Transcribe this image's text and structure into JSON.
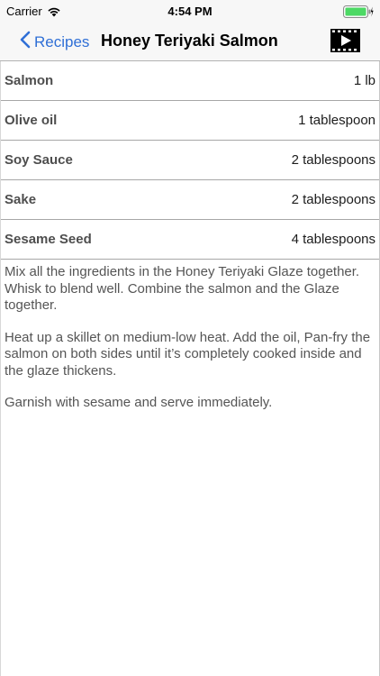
{
  "status_bar": {
    "carrier": "Carrier",
    "time": "4:54 PM"
  },
  "nav": {
    "back_label": "Recipes",
    "title": "Honey Teriyaki Salmon",
    "accent_color": "#2f6fd6",
    "video_icon": "video-play-icon"
  },
  "ingredients": [
    {
      "name": "Salmon",
      "quantity": "1 lb"
    },
    {
      "name": "Olive oil",
      "quantity": "1 tablespoon"
    },
    {
      "name": "Soy Sauce",
      "quantity": "2 tablespoons"
    },
    {
      "name": "Sake",
      "quantity": "2 tablespoons"
    },
    {
      "name": "Sesame Seed",
      "quantity": "4 tablespoons"
    }
  ],
  "instructions": [
    "Mix all the ingredients in the Honey Teriyaki Glaze together. Whisk to blend well. Combine the salmon and the Glaze together.",
    "Heat up a skillet on medium-low heat. Add the oil, Pan-fry the salmon on both sides until it’s completely cooked inside and the glaze thickens.",
    "Garnish with sesame and serve immediately."
  ]
}
